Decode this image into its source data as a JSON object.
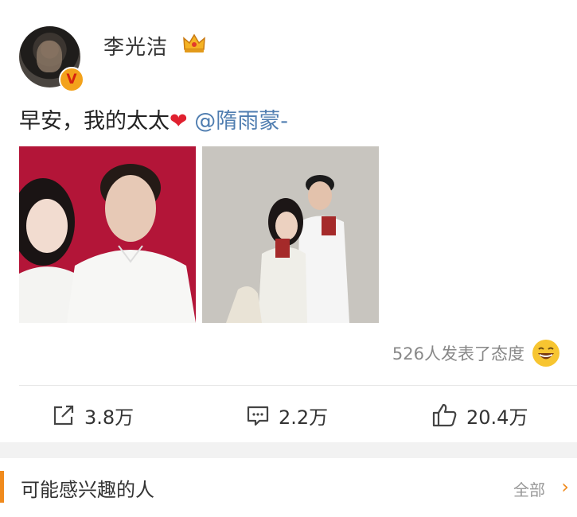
{
  "post": {
    "username": "李光洁",
    "text": "早安，我的太太",
    "heart": "❤",
    "mention": "@隋雨蒙-",
    "verify_badge": "V",
    "reaction_text": "526人发表了态度",
    "icons": {
      "avatar": "avatar",
      "crown": "crown-icon",
      "verified": "verified-badge-icon",
      "reaction": "laughing-emoji-icon"
    }
  },
  "actions": {
    "share_count": "3.8万",
    "comment_count": "2.2万",
    "like_count": "20.4万"
  },
  "section": {
    "title": "可能感兴趣的人",
    "more_label": "全部",
    "chevron": "›"
  },
  "colors": {
    "accent": "#f08a1c",
    "mention": "#4f7db0",
    "heart": "#e0202f"
  }
}
